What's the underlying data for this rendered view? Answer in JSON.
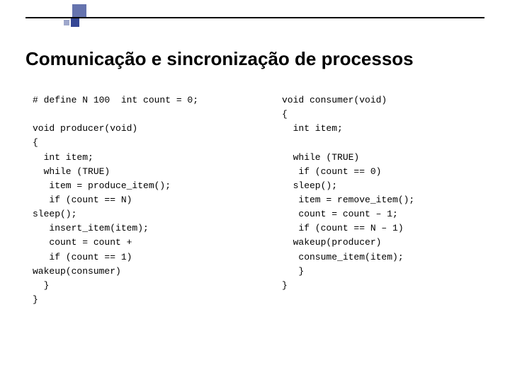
{
  "title": "Comunicação e sincronização de processos",
  "code": {
    "left": "# define N 100  int count = 0;\n\nvoid producer(void)\n{\n  int item;\n  while (TRUE)\n   item = produce_item();\n   if (count == N)\nsleep();\n   insert_item(item);\n   count = count +\n   if (count == 1)\nwakeup(consumer)\n  }\n}",
    "right": "void consumer(void)\n{\n  int item;\n\n  while (TRUE)\n   if (count == 0)\n  sleep();\n   item = remove_item();\n   count = count – 1;\n   if (count == N – 1)\n  wakeup(producer)\n   consume_item(item);\n   }\n}"
  }
}
